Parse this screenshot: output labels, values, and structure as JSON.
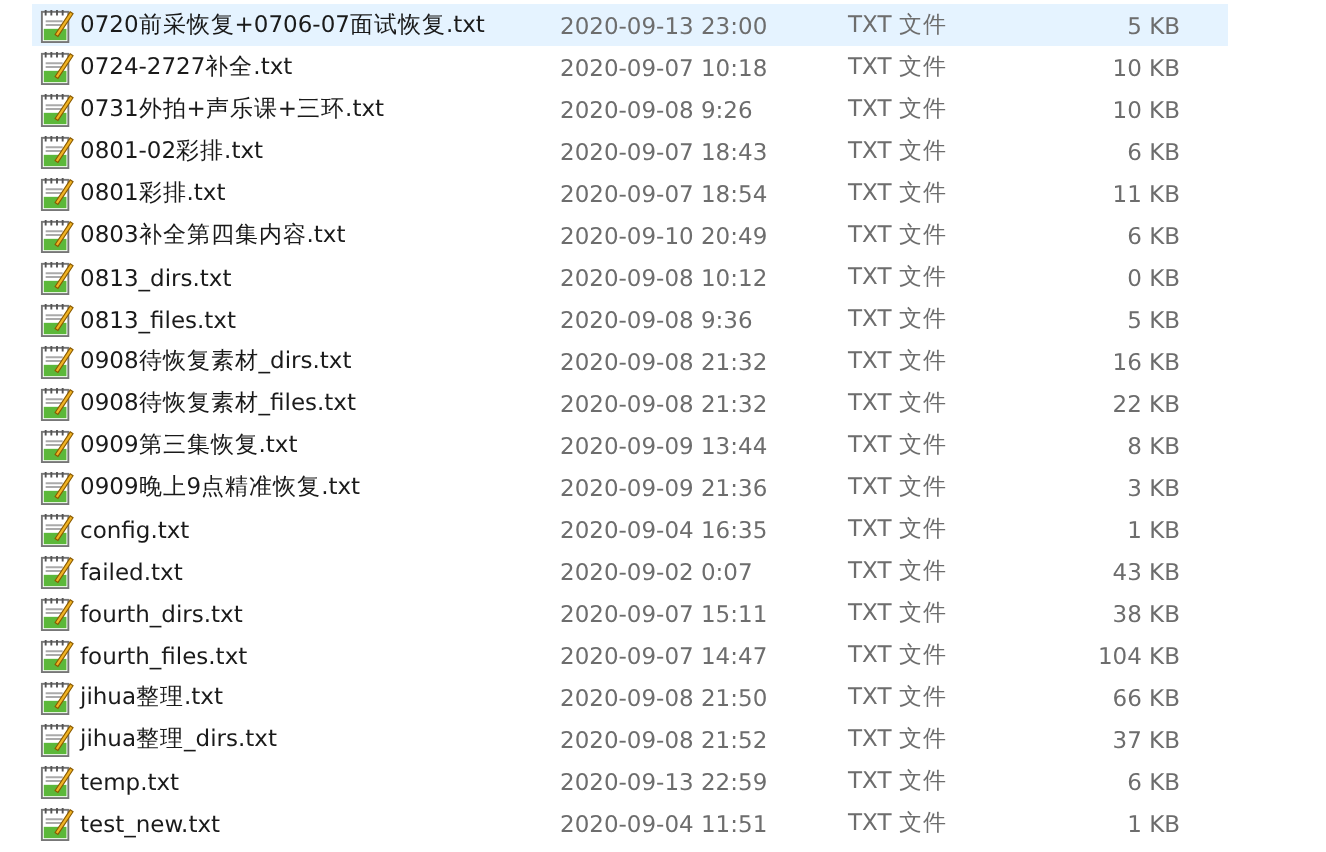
{
  "files": [
    {
      "name": "0720前采恢复+0706-07面试恢复.txt",
      "modified": "2020-09-13 23:00",
      "type": "TXT 文件",
      "size": "5 KB",
      "selected": true
    },
    {
      "name": "0724-2727补全.txt",
      "modified": "2020-09-07 10:18",
      "type": "TXT 文件",
      "size": "10 KB",
      "selected": false
    },
    {
      "name": "0731外拍+声乐课+三环.txt",
      "modified": "2020-09-08 9:26",
      "type": "TXT 文件",
      "size": "10 KB",
      "selected": false
    },
    {
      "name": "0801-02彩排.txt",
      "modified": "2020-09-07 18:43",
      "type": "TXT 文件",
      "size": "6 KB",
      "selected": false
    },
    {
      "name": "0801彩排.txt",
      "modified": "2020-09-07 18:54",
      "type": "TXT 文件",
      "size": "11 KB",
      "selected": false
    },
    {
      "name": "0803补全第四集内容.txt",
      "modified": "2020-09-10 20:49",
      "type": "TXT 文件",
      "size": "6 KB",
      "selected": false
    },
    {
      "name": "0813_dirs.txt",
      "modified": "2020-09-08 10:12",
      "type": "TXT 文件",
      "size": "0 KB",
      "selected": false
    },
    {
      "name": "0813_files.txt",
      "modified": "2020-09-08 9:36",
      "type": "TXT 文件",
      "size": "5 KB",
      "selected": false
    },
    {
      "name": "0908待恢复素材_dirs.txt",
      "modified": "2020-09-08 21:32",
      "type": "TXT 文件",
      "size": "16 KB",
      "selected": false
    },
    {
      "name": "0908待恢复素材_files.txt",
      "modified": "2020-09-08 21:32",
      "type": "TXT 文件",
      "size": "22 KB",
      "selected": false
    },
    {
      "name": "0909第三集恢复.txt",
      "modified": "2020-09-09 13:44",
      "type": "TXT 文件",
      "size": "8 KB",
      "selected": false
    },
    {
      "name": "0909晚上9点精准恢复.txt",
      "modified": "2020-09-09 21:36",
      "type": "TXT 文件",
      "size": "3 KB",
      "selected": false
    },
    {
      "name": "config.txt",
      "modified": "2020-09-04 16:35",
      "type": "TXT 文件",
      "size": "1 KB",
      "selected": false
    },
    {
      "name": "failed.txt",
      "modified": "2020-09-02 0:07",
      "type": "TXT 文件",
      "size": "43 KB",
      "selected": false
    },
    {
      "name": "fourth_dirs.txt",
      "modified": "2020-09-07 15:11",
      "type": "TXT 文件",
      "size": "38 KB",
      "selected": false
    },
    {
      "name": "fourth_files.txt",
      "modified": "2020-09-07 14:47",
      "type": "TXT 文件",
      "size": "104 KB",
      "selected": false
    },
    {
      "name": "jihua整理.txt",
      "modified": "2020-09-08 21:50",
      "type": "TXT 文件",
      "size": "66 KB",
      "selected": false
    },
    {
      "name": "jihua整理_dirs.txt",
      "modified": "2020-09-08 21:52",
      "type": "TXT 文件",
      "size": "37 KB",
      "selected": false
    },
    {
      "name": "temp.txt",
      "modified": "2020-09-13 22:59",
      "type": "TXT 文件",
      "size": "6 KB",
      "selected": false
    },
    {
      "name": "test_new.txt",
      "modified": "2020-09-04 11:51",
      "type": "TXT 文件",
      "size": "1 KB",
      "selected": false
    }
  ]
}
